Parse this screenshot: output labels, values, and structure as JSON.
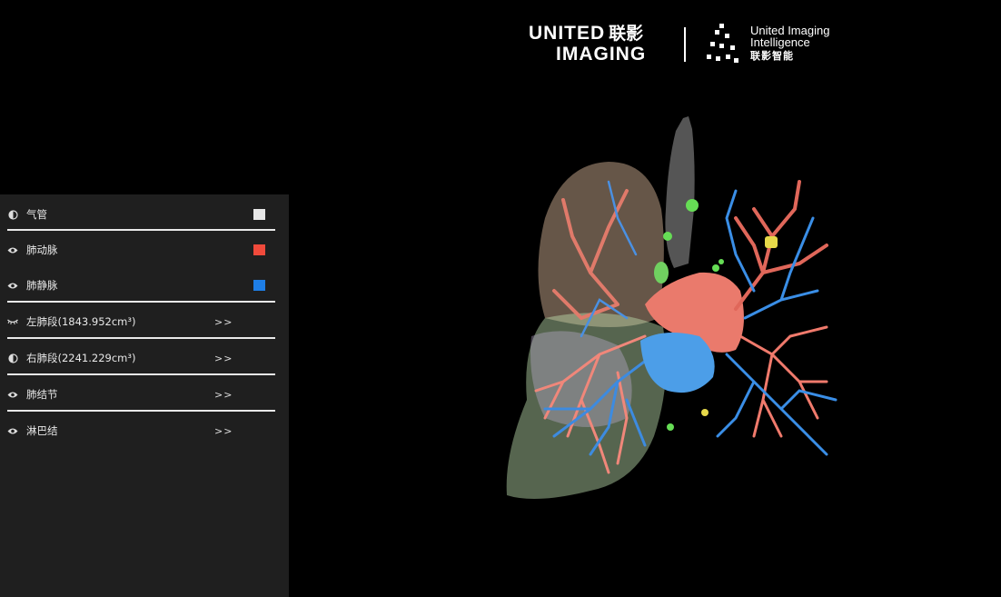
{
  "logo": {
    "line1": "UNITED",
    "line1_cn": "联影",
    "line2": "IMAGING",
    "sub1": "United Imaging",
    "sub2": "Intelligence",
    "sub_cn": "联影智能"
  },
  "panel": {
    "items": [
      {
        "label": "气管",
        "icon": "half-circle-icon",
        "swatch": "#e6e6e6"
      },
      {
        "label": "肺动脉",
        "icon": "eye-icon",
        "swatch": "#f04a3b"
      },
      {
        "label": "肺静脉",
        "icon": "eye-icon",
        "swatch": "#1e7ee6"
      },
      {
        "label": "左肺段(1843.952cm³)",
        "icon": "eye-closed-icon",
        "more": ">>"
      },
      {
        "label": "右肺段(2241.229cm³)",
        "icon": "half-circle-icon",
        "more": ">>"
      },
      {
        "label": "肺结节",
        "icon": "eye-icon",
        "more": ">>"
      },
      {
        "label": "淋巴结",
        "icon": "eye-icon",
        "more": ">>"
      }
    ]
  }
}
